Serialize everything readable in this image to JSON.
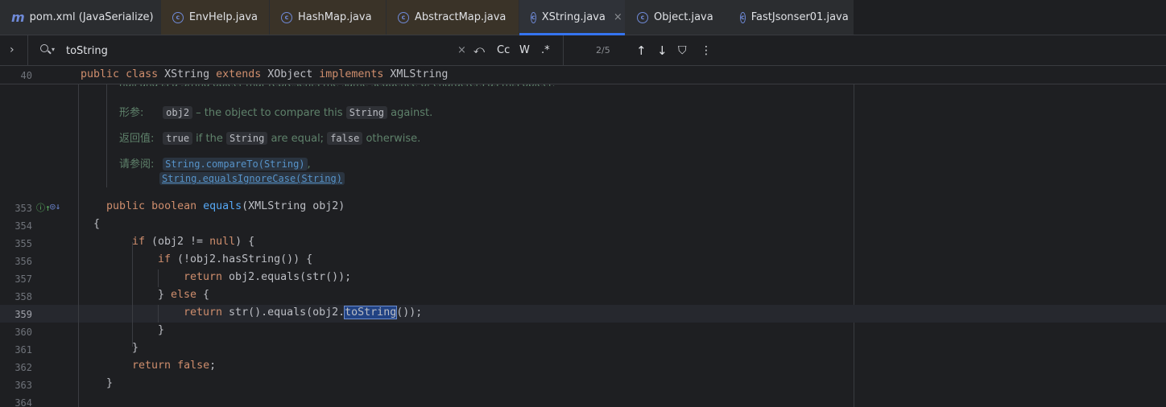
{
  "tabs": [
    {
      "label": "pom.xml (JavaSerialize)",
      "icon": "maven-m-icon"
    },
    {
      "label": "EnvHelp.java",
      "icon": "class-c-icon"
    },
    {
      "label": "HashMap.java",
      "icon": "class-c-icon"
    },
    {
      "label": "AbstractMap.java",
      "icon": "class-c-icon"
    },
    {
      "label": "XString.java",
      "icon": "class-c-icon",
      "active": true
    },
    {
      "label": "Object.java",
      "icon": "class-c-icon"
    },
    {
      "label": "FastJsonser01.java",
      "icon": "class-c-icon"
    }
  ],
  "tab_close_glyph": "×",
  "search": {
    "query": "toString",
    "match_count": "2/5",
    "case_label": "Cc",
    "word_label": "W",
    "regex_label": ".*",
    "clear_glyph": "×",
    "expand_glyph": "›",
    "history_glyph": "⤺",
    "prev_glyph": "↑",
    "next_glyph": "↓",
    "filter_glyph": "⛉",
    "more_glyph": "⋮"
  },
  "sticky": {
    "line_no": "40",
    "kw1": "public",
    "kw2": "class",
    "name": "XString",
    "kw3": "extends",
    "parent": "XObject",
    "kw4": "implements",
    "iface": "XMLString"
  },
  "doc": {
    "clipped_line": "null and is a String object that represents the same sequence of characters as this object.",
    "params_label": "形参:",
    "param_name": "obj2",
    "param_desc_pre": " – the object to compare this ",
    "param_chip": "String",
    "param_desc_post": " against.",
    "returns_label": "返回值:",
    "ret_true": "true",
    "ret_mid1": " if the ",
    "ret_chip": "String",
    "ret_mid2": " are equal; ",
    "ret_false": "false",
    "ret_end": " otherwise.",
    "see_label": "请参阅:",
    "see1": "String.compareTo(String)",
    "see1_comma": ",",
    "see2": "String.equalsIgnoreCase(String)"
  },
  "code_lines": [
    {
      "no": "353"
    },
    {
      "no": "354"
    },
    {
      "no": "355"
    },
    {
      "no": "356"
    },
    {
      "no": "357"
    },
    {
      "no": "358"
    },
    {
      "no": "359"
    },
    {
      "no": "360"
    },
    {
      "no": "361"
    },
    {
      "no": "362"
    },
    {
      "no": "363"
    },
    {
      "no": "364"
    }
  ],
  "code": {
    "l353_kw1": "public",
    "l353_kw2": "boolean",
    "l353_fn": "equals",
    "l353_rest": "(XMLString obj2)",
    "l354": "{",
    "l355_kw": "if",
    "l355_mid": " (obj2 != ",
    "l355_null": "null",
    "l355_end": ") {",
    "l356_kw": "if",
    "l356_rest": " (!obj2.hasString()) {",
    "l357_kw": "return",
    "l357_rest": " obj2.equals(str());",
    "l358_pre": "} ",
    "l358_kw": "else",
    "l358_end": " {",
    "l359_kw": "return",
    "l359_pre": " str().equals(obj2.",
    "l359_match": "toString",
    "l359_end": "());",
    "l360": "}",
    "l361": "}",
    "l362_kw": "return",
    "l362_false": "false",
    "l362_end": ";",
    "l363": "}"
  }
}
